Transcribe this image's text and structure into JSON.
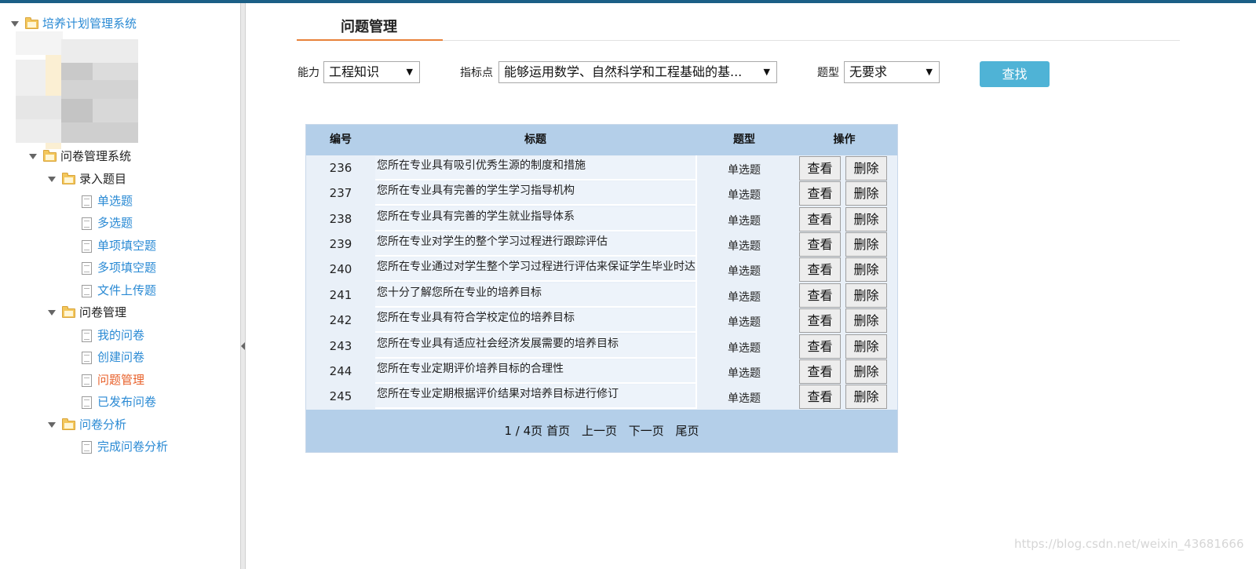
{
  "sidebar": {
    "root": "培养计划管理系统",
    "survey_system": "问卷管理系统",
    "groups": [
      {
        "label": "录入题目",
        "items": [
          "单选题",
          "多选题",
          "单项填空题",
          "多项填空题",
          "文件上传题"
        ]
      },
      {
        "label": "问卷管理",
        "items": [
          "我的问卷",
          "创建问卷",
          "问题管理",
          "已发布问卷"
        ]
      },
      {
        "label": "问卷分析",
        "items": [
          "完成问卷分析"
        ]
      }
    ],
    "active_item": "问题管理"
  },
  "main": {
    "title": "问题管理",
    "filters": {
      "ability_label": "能力",
      "ability_value": "工程知识",
      "indicator_label": "指标点",
      "indicator_value": "能够运用数学、自然科学和工程基础的基...",
      "type_label": "题型",
      "type_value": "无要求",
      "search_label": "查找"
    },
    "table": {
      "headers": [
        "编号",
        "标题",
        "题型",
        "操作"
      ],
      "view_label": "查看",
      "delete_label": "删除",
      "rows": [
        {
          "id": "236",
          "title": "您所在专业具有吸引优秀生源的制度和措施",
          "type": "单选题"
        },
        {
          "id": "237",
          "title": "您所在专业具有完善的学生学习指导机构",
          "type": "单选题"
        },
        {
          "id": "238",
          "title": "您所在专业具有完善的学生就业指导体系",
          "type": "单选题"
        },
        {
          "id": "239",
          "title": "您所在专业对学生的整个学习过程进行跟踪评估",
          "type": "单选题"
        },
        {
          "id": "240",
          "title": "您所在专业通过对学生整个学习过程进行评估来保证学生毕业时达到毕业要求",
          "type": "单选题"
        },
        {
          "id": "241",
          "title": "您十分了解您所在专业的培养目标",
          "type": "单选题"
        },
        {
          "id": "242",
          "title": "您所在专业具有符合学校定位的培养目标",
          "type": "单选题"
        },
        {
          "id": "243",
          "title": "您所在专业具有适应社会经济发展需要的培养目标",
          "type": "单选题"
        },
        {
          "id": "244",
          "title": "您所在专业定期评价培养目标的合理性",
          "type": "单选题"
        },
        {
          "id": "245",
          "title": "您所在专业定期根据评价结果对培养目标进行修订",
          "type": "单选题"
        }
      ]
    },
    "pager": {
      "info": "1 / 4页",
      "first": "首页",
      "prev": "上一页",
      "next": "下一页",
      "last": "尾页"
    }
  },
  "watermark": "https://blog.csdn.net/weixin_43681666",
  "colors": {
    "top_bar": "#1b5f86",
    "link": "#2a8ad4",
    "active": "#e8612b",
    "table_header": "#b4cfe9",
    "search_button": "#4fb3d6"
  }
}
